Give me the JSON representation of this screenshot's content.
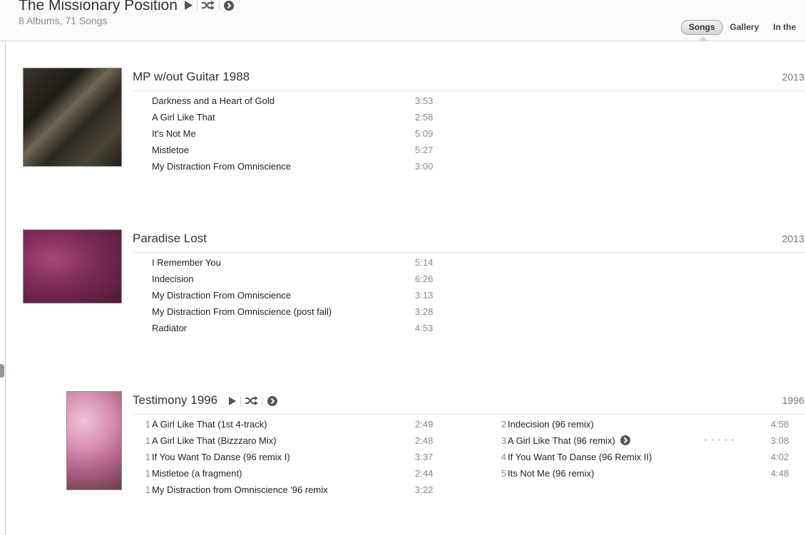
{
  "header": {
    "artist": "The Missionary Position",
    "subtitle": "8 Albums, 71 Songs",
    "tabs": [
      "Songs",
      "Gallery",
      "In the"
    ],
    "active_tab": "Songs"
  },
  "icons": {
    "play": "play-icon",
    "shuffle": "shuffle-icon",
    "more": "arrow-circle-icon"
  },
  "albums": [
    {
      "title": "MP w/out Guitar 1988",
      "year": "2013",
      "colors": [
        "#2e2a24",
        "#6b6252",
        "#4a4433"
      ],
      "tracks": [
        {
          "name": "Darkness and a Heart of Gold",
          "duration": "3:53"
        },
        {
          "name": "A Girl Like That",
          "duration": "2:58"
        },
        {
          "name": "It's Not Me",
          "duration": "5:09"
        },
        {
          "name": "Mistletoe",
          "duration": "5:27"
        },
        {
          "name": "My Distraction From Omniscience",
          "duration": "3:00"
        }
      ]
    },
    {
      "title": "Paradise Lost",
      "year": "2013",
      "colors": [
        "#7a2a55",
        "#9a3d70",
        "#5c1f40"
      ],
      "tracks": [
        {
          "name": "I Remember You",
          "duration": "5:14"
        },
        {
          "name": "Indecision",
          "duration": "6:26"
        },
        {
          "name": "My Distraction From Omniscience",
          "duration": "3:13"
        },
        {
          "name": "My Distraction From Omniscience (post fall)",
          "duration": "3:28"
        },
        {
          "name": "Radiator",
          "duration": "4:53"
        }
      ]
    },
    {
      "title": "Testimony 1996",
      "year": "1996",
      "colors": [
        "#c87aa0",
        "#e2b0c8",
        "#6a3a4a"
      ],
      "tracks_left": [
        {
          "num": "1",
          "name": "A Girl Like That (1st 4-track)",
          "duration": "2:49"
        },
        {
          "num": "1",
          "name": "A Girl Like That (Bizzzaro Mix)",
          "duration": "2:48"
        },
        {
          "num": "1",
          "name": "If You Want To Danse (96 remix I)",
          "duration": "3:37"
        },
        {
          "num": "1",
          "name": "Mistletoe (a fragment)",
          "duration": "2:44"
        },
        {
          "num": "1",
          "name": "My Distraction from Omniscience '96 remix",
          "duration": "3:22"
        }
      ],
      "tracks_right": [
        {
          "num": "2",
          "name": "Indecision (96 remix)",
          "duration": "4:58"
        },
        {
          "num": "3",
          "name": "A Girl Like That (96 remix)",
          "duration": "3:08"
        },
        {
          "num": "4",
          "name": "If You Want To Danse (96 Remix II)",
          "duration": "4:02"
        },
        {
          "num": "5",
          "name": "Its Not Me (96 remix)",
          "duration": "4:48"
        }
      ]
    }
  ]
}
